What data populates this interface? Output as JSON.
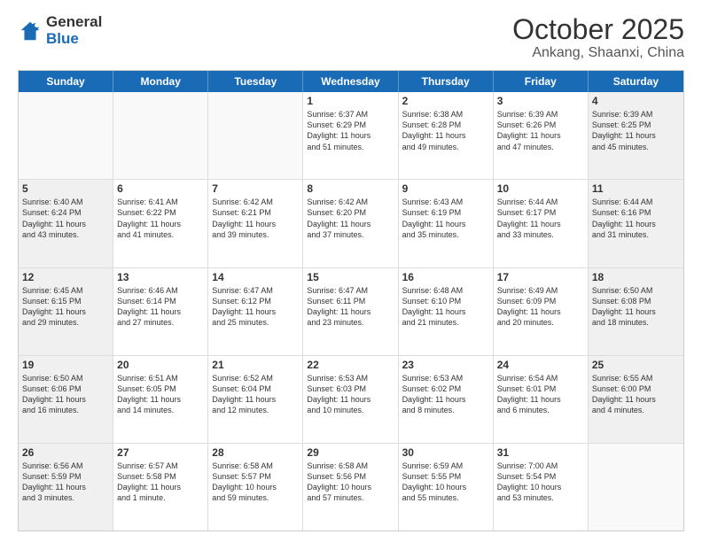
{
  "header": {
    "logo_general": "General",
    "logo_blue": "Blue",
    "title": "October 2025",
    "subtitle": "Ankang, Shaanxi, China"
  },
  "days": [
    "Sunday",
    "Monday",
    "Tuesday",
    "Wednesday",
    "Thursday",
    "Friday",
    "Saturday"
  ],
  "weeks": [
    [
      {
        "day": "",
        "info": "",
        "shaded": true
      },
      {
        "day": "",
        "info": "",
        "shaded": true
      },
      {
        "day": "",
        "info": "",
        "shaded": true
      },
      {
        "day": "1",
        "info": "Sunrise: 6:37 AM\nSunset: 6:29 PM\nDaylight: 11 hours\nand 51 minutes.",
        "shaded": false
      },
      {
        "day": "2",
        "info": "Sunrise: 6:38 AM\nSunset: 6:28 PM\nDaylight: 11 hours\nand 49 minutes.",
        "shaded": false
      },
      {
        "day": "3",
        "info": "Sunrise: 6:39 AM\nSunset: 6:26 PM\nDaylight: 11 hours\nand 47 minutes.",
        "shaded": false
      },
      {
        "day": "4",
        "info": "Sunrise: 6:39 AM\nSunset: 6:25 PM\nDaylight: 11 hours\nand 45 minutes.",
        "shaded": true
      }
    ],
    [
      {
        "day": "5",
        "info": "Sunrise: 6:40 AM\nSunset: 6:24 PM\nDaylight: 11 hours\nand 43 minutes.",
        "shaded": true
      },
      {
        "day": "6",
        "info": "Sunrise: 6:41 AM\nSunset: 6:22 PM\nDaylight: 11 hours\nand 41 minutes.",
        "shaded": false
      },
      {
        "day": "7",
        "info": "Sunrise: 6:42 AM\nSunset: 6:21 PM\nDaylight: 11 hours\nand 39 minutes.",
        "shaded": false
      },
      {
        "day": "8",
        "info": "Sunrise: 6:42 AM\nSunset: 6:20 PM\nDaylight: 11 hours\nand 37 minutes.",
        "shaded": false
      },
      {
        "day": "9",
        "info": "Sunrise: 6:43 AM\nSunset: 6:19 PM\nDaylight: 11 hours\nand 35 minutes.",
        "shaded": false
      },
      {
        "day": "10",
        "info": "Sunrise: 6:44 AM\nSunset: 6:17 PM\nDaylight: 11 hours\nand 33 minutes.",
        "shaded": false
      },
      {
        "day": "11",
        "info": "Sunrise: 6:44 AM\nSunset: 6:16 PM\nDaylight: 11 hours\nand 31 minutes.",
        "shaded": true
      }
    ],
    [
      {
        "day": "12",
        "info": "Sunrise: 6:45 AM\nSunset: 6:15 PM\nDaylight: 11 hours\nand 29 minutes.",
        "shaded": true
      },
      {
        "day": "13",
        "info": "Sunrise: 6:46 AM\nSunset: 6:14 PM\nDaylight: 11 hours\nand 27 minutes.",
        "shaded": false
      },
      {
        "day": "14",
        "info": "Sunrise: 6:47 AM\nSunset: 6:12 PM\nDaylight: 11 hours\nand 25 minutes.",
        "shaded": false
      },
      {
        "day": "15",
        "info": "Sunrise: 6:47 AM\nSunset: 6:11 PM\nDaylight: 11 hours\nand 23 minutes.",
        "shaded": false
      },
      {
        "day": "16",
        "info": "Sunrise: 6:48 AM\nSunset: 6:10 PM\nDaylight: 11 hours\nand 21 minutes.",
        "shaded": false
      },
      {
        "day": "17",
        "info": "Sunrise: 6:49 AM\nSunset: 6:09 PM\nDaylight: 11 hours\nand 20 minutes.",
        "shaded": false
      },
      {
        "day": "18",
        "info": "Sunrise: 6:50 AM\nSunset: 6:08 PM\nDaylight: 11 hours\nand 18 minutes.",
        "shaded": true
      }
    ],
    [
      {
        "day": "19",
        "info": "Sunrise: 6:50 AM\nSunset: 6:06 PM\nDaylight: 11 hours\nand 16 minutes.",
        "shaded": true
      },
      {
        "day": "20",
        "info": "Sunrise: 6:51 AM\nSunset: 6:05 PM\nDaylight: 11 hours\nand 14 minutes.",
        "shaded": false
      },
      {
        "day": "21",
        "info": "Sunrise: 6:52 AM\nSunset: 6:04 PM\nDaylight: 11 hours\nand 12 minutes.",
        "shaded": false
      },
      {
        "day": "22",
        "info": "Sunrise: 6:53 AM\nSunset: 6:03 PM\nDaylight: 11 hours\nand 10 minutes.",
        "shaded": false
      },
      {
        "day": "23",
        "info": "Sunrise: 6:53 AM\nSunset: 6:02 PM\nDaylight: 11 hours\nand 8 minutes.",
        "shaded": false
      },
      {
        "day": "24",
        "info": "Sunrise: 6:54 AM\nSunset: 6:01 PM\nDaylight: 11 hours\nand 6 minutes.",
        "shaded": false
      },
      {
        "day": "25",
        "info": "Sunrise: 6:55 AM\nSunset: 6:00 PM\nDaylight: 11 hours\nand 4 minutes.",
        "shaded": true
      }
    ],
    [
      {
        "day": "26",
        "info": "Sunrise: 6:56 AM\nSunset: 5:59 PM\nDaylight: 11 hours\nand 3 minutes.",
        "shaded": true
      },
      {
        "day": "27",
        "info": "Sunrise: 6:57 AM\nSunset: 5:58 PM\nDaylight: 11 hours\nand 1 minute.",
        "shaded": false
      },
      {
        "day": "28",
        "info": "Sunrise: 6:58 AM\nSunset: 5:57 PM\nDaylight: 10 hours\nand 59 minutes.",
        "shaded": false
      },
      {
        "day": "29",
        "info": "Sunrise: 6:58 AM\nSunset: 5:56 PM\nDaylight: 10 hours\nand 57 minutes.",
        "shaded": false
      },
      {
        "day": "30",
        "info": "Sunrise: 6:59 AM\nSunset: 5:55 PM\nDaylight: 10 hours\nand 55 minutes.",
        "shaded": false
      },
      {
        "day": "31",
        "info": "Sunrise: 7:00 AM\nSunset: 5:54 PM\nDaylight: 10 hours\nand 53 minutes.",
        "shaded": false
      },
      {
        "day": "",
        "info": "",
        "shaded": true
      }
    ]
  ]
}
